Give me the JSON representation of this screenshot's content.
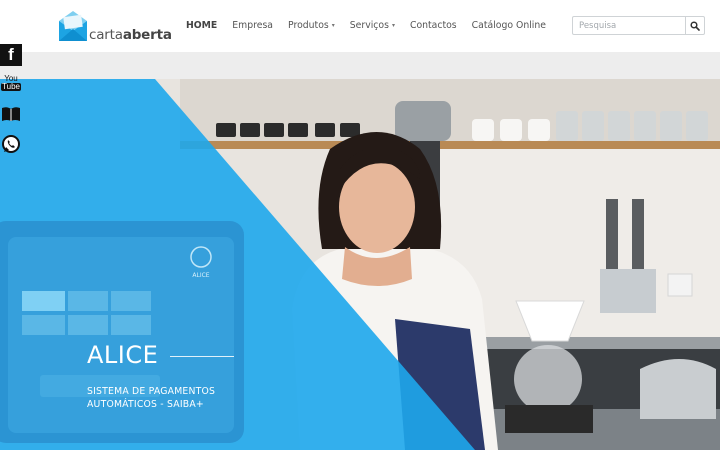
{
  "brand": {
    "name_light": "carta",
    "name_bold": "aberta",
    "accent": "#29a9e6"
  },
  "nav": {
    "items": [
      {
        "label": "HOME",
        "active": true,
        "dropdown": false
      },
      {
        "label": "Empresa",
        "active": false,
        "dropdown": false
      },
      {
        "label": "Produtos",
        "active": false,
        "dropdown": true
      },
      {
        "label": "Serviços",
        "active": false,
        "dropdown": true
      },
      {
        "label": "Contactos",
        "active": false,
        "dropdown": false
      },
      {
        "label": "Catálogo Online",
        "active": false,
        "dropdown": false
      }
    ],
    "caret": "▾"
  },
  "search": {
    "placeholder": "Pesquisa",
    "value": "",
    "icon": "search-icon"
  },
  "hero": {
    "title": "ALICE",
    "subtitle": "SISTEMA DE PAGAMENTOS AUTOMÁTICOS - SAIBA+",
    "overlay_color": "#1ea7ec",
    "terminal_label": "ALICE"
  },
  "social": [
    {
      "icon": "facebook-icon",
      "glyph": "f"
    },
    {
      "icon": "youtube-icon",
      "line1": "You",
      "line2": "Tube"
    },
    {
      "icon": "catalog-book-icon"
    },
    {
      "icon": "whatsapp-icon"
    }
  ]
}
